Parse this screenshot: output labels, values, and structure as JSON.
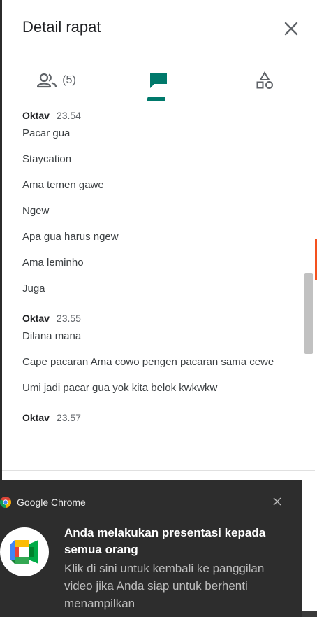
{
  "header": {
    "title": "Detail rapat",
    "close_icon": "close-icon"
  },
  "tabs": {
    "people_icon": "people-icon",
    "people_count": "(5)",
    "chat_icon": "chat-icon",
    "activities_icon": "shapes-icon",
    "active": "chat",
    "accent_color": "#00796b"
  },
  "messages": [
    {
      "sender": "Oktav",
      "time": "23.54",
      "lines": [
        "Pacar gua",
        "Staycation",
        "Ama temen gawe",
        "Ngew",
        "Apa gua harus ngew",
        "Ama leminho",
        "Juga"
      ]
    },
    {
      "sender": "Oktav",
      "time": "23.55",
      "lines": [
        "Dilana mana",
        "Cape pacaran Ama cowo pengen pacaran sama cewe",
        "Umi jadi pacar gua yok kita belok kwkwkw"
      ]
    },
    {
      "sender": "Oktav",
      "time": "23.57",
      "lines": []
    }
  ],
  "notification": {
    "app_name": "Google Chrome",
    "app_icon": "chrome-icon",
    "meet_icon": "google-meet-icon",
    "title": "Anda melakukan presentasi kepada semua orang",
    "body": "Klik di sini untuk kembali ke panggilan video jika Anda siap untuk berhenti menampilkan",
    "close_icon": "close-icon"
  }
}
